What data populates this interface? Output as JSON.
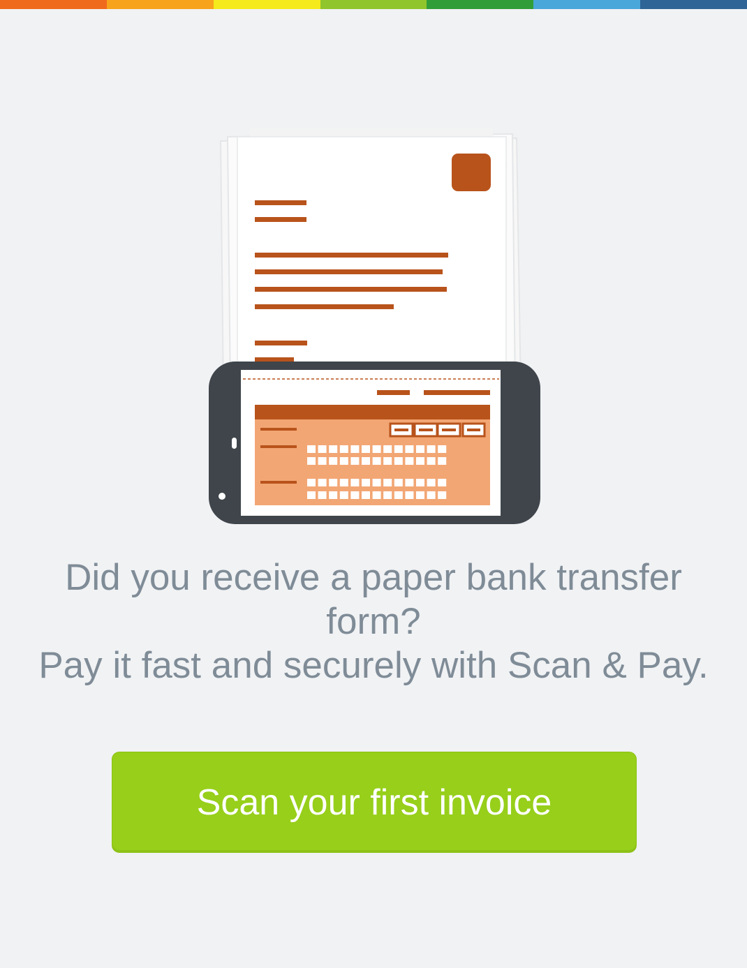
{
  "header": {
    "stripe_colors": [
      "#f06a1d",
      "#f7a31c",
      "#f4ea1c",
      "#90c52b",
      "#319d38",
      "#4aa7d9",
      "#2f6496"
    ]
  },
  "illustration": {
    "icon": "scan-document-with-phone-icon",
    "colors": {
      "accent": "#b8531b",
      "form_fill": "#f2a674",
      "phone_body": "#3f454b",
      "paper": "#ffffff"
    }
  },
  "message": {
    "line1": "Did you receive a paper bank transfer",
    "line2": "form?",
    "line3": "Pay it fast and securely with Scan & Pay."
  },
  "cta": {
    "label": "Scan your first invoice",
    "color": "#97cf1a"
  }
}
